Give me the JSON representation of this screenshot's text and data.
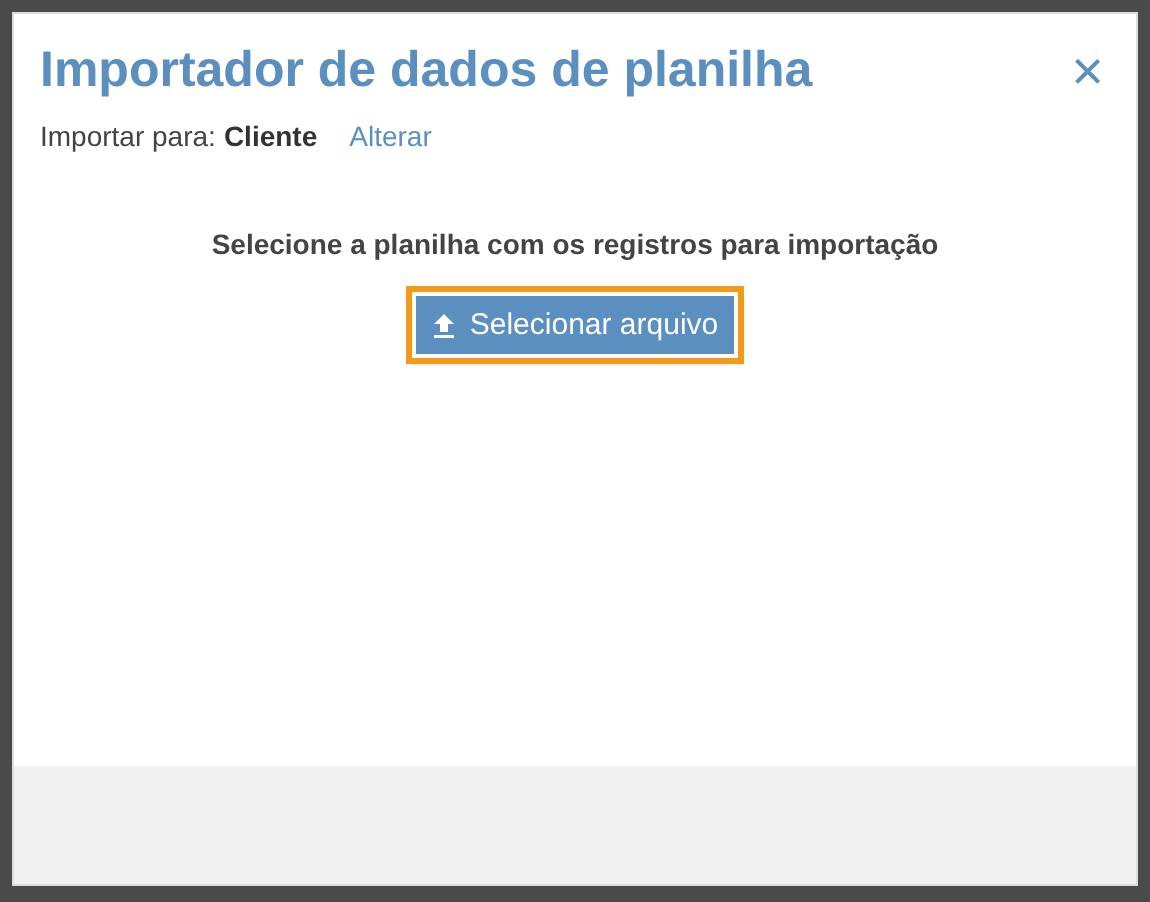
{
  "dialog": {
    "title": "Importador de dados de planilha",
    "close": "×"
  },
  "target": {
    "label": "Importar para:",
    "value": "Cliente",
    "link": "Alterar"
  },
  "prompt": "Selecione a planilha com os registros para importação",
  "upload_button": {
    "label": "Selecionar arquivo",
    "focused": true
  }
}
